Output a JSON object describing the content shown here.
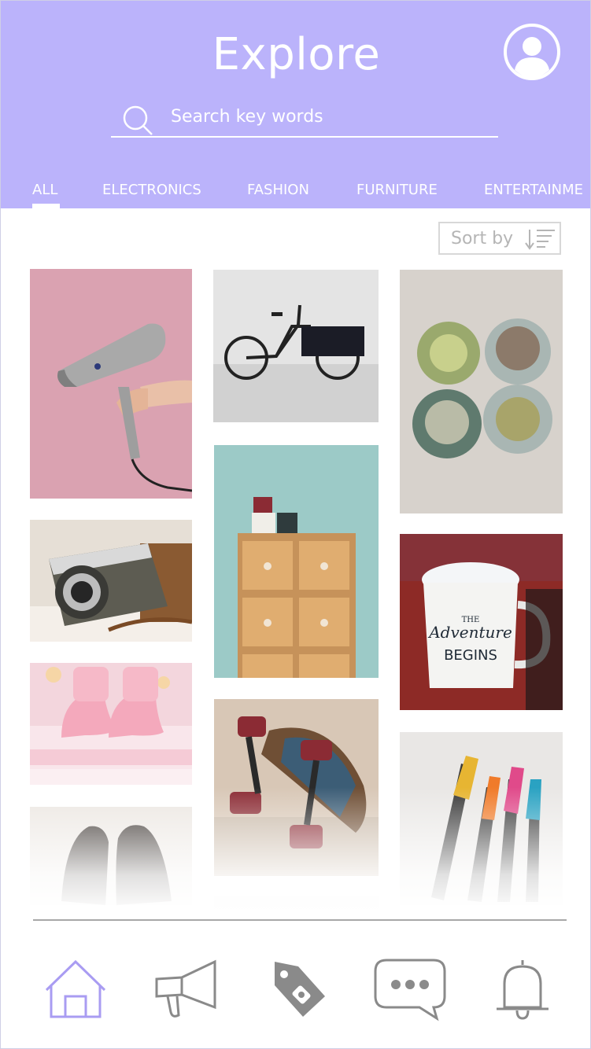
{
  "header": {
    "title": "Explore",
    "search_placeholder": "Search key words",
    "profile_icon": "user-avatar-icon",
    "search_icon": "search-icon"
  },
  "tabs": [
    {
      "label": "ALL",
      "active": true
    },
    {
      "label": "ELECTRONICS",
      "active": false
    },
    {
      "label": "FASHION",
      "active": false
    },
    {
      "label": "FURNITURE",
      "active": false
    },
    {
      "label": "ENTERTAINME",
      "active": false
    }
  ],
  "sort": {
    "label": "Sort by",
    "icon": "sort-descending-icon"
  },
  "products": [
    {
      "subject": "hair dryer",
      "color": "#d59aa9"
    },
    {
      "subject": "cargo bike",
      "color": "#dcdcdc"
    },
    {
      "subject": "succulents",
      "color": "#d7d2cc"
    },
    {
      "subject": "film camera",
      "color": "#e6dfd6"
    },
    {
      "subject": "wooden drawers with mugs",
      "color": "#9ccac7"
    },
    {
      "subject": "enamel mug",
      "color": "#8d2a26"
    },
    {
      "subject": "baby booties",
      "color": "#f3d6dd"
    },
    {
      "subject": "skateboard",
      "color": "#d8c7b6"
    },
    {
      "subject": "leather shoes",
      "color": "#ece7e2"
    },
    {
      "subject": "felt tip pens",
      "color": "#e9e7e5"
    }
  ],
  "mug_text": {
    "line1": "THE",
    "line2": "Adventure",
    "line3": "BEGINS"
  },
  "bottom_nav": [
    {
      "icon": "home-icon",
      "active": true
    },
    {
      "icon": "megaphone-icon",
      "active": false
    },
    {
      "icon": "price-tag-icon",
      "active": false
    },
    {
      "icon": "chat-bubble-icon",
      "active": false
    },
    {
      "icon": "bell-icon",
      "active": false
    }
  ],
  "colors": {
    "accent": "#bbb3fb",
    "nav_active": "#a99cf2",
    "nav_inactive": "#8a8a8a"
  }
}
